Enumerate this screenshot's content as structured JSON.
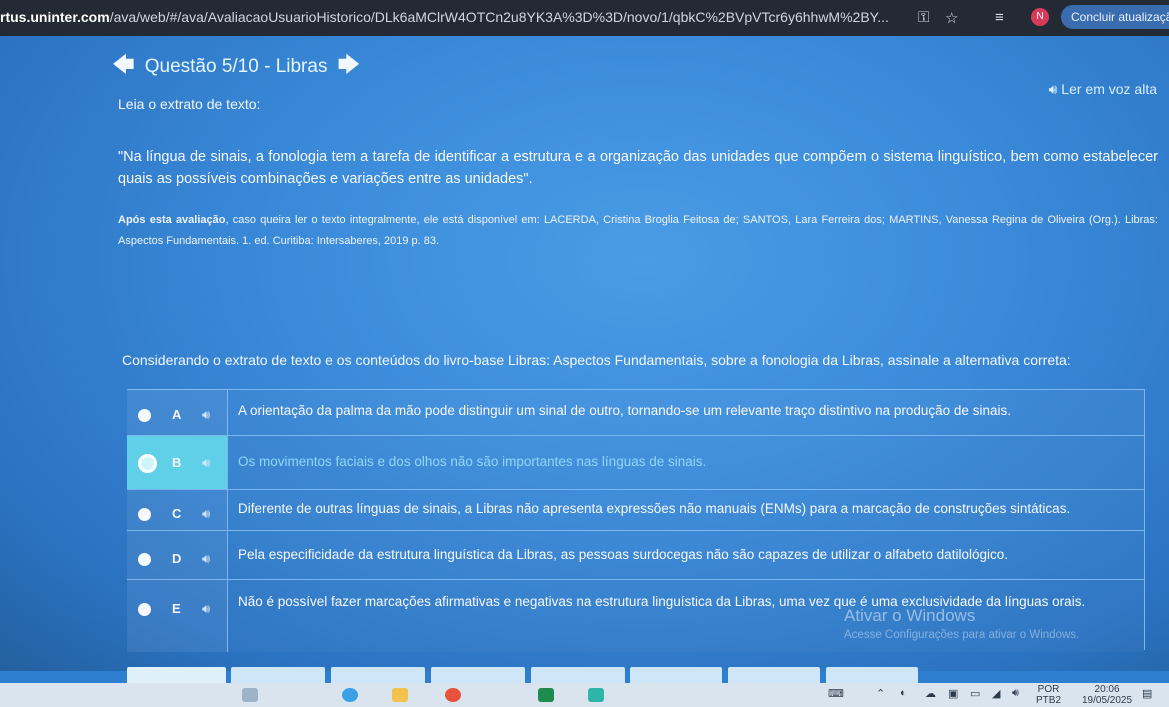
{
  "browser": {
    "url_host": "rtus.uninter.com",
    "url_path": "/ava/web/#/ava/AvaliacaoUsuarioHistorico/DLk6aMClrW4OTCn2u8YK3A%3D%3D/novo/1/qbkC%2BVpVTcr6y6hhwM%2BY...",
    "profile_letter": "N",
    "update_button": "Concluir atualizaçã"
  },
  "header": {
    "question_title": "Questão 5/10 - Libras",
    "read_aloud": "Ler em voz alta"
  },
  "content": {
    "lead": "Leia o extrato de texto:",
    "quote": "\"Na língua de sinais, a fonologia tem a tarefa de identificar a estrutura e a organização das unidades que compõem o sistema linguístico, bem como estabelecer quais as possíveis combinações e variações entre as unidades\".",
    "source_bold": "Após esta avaliação",
    "source_rest": ", caso queira ler o texto integralmente, ele está disponível em: LACERDA, Cristina Broglia Feitosa de; SANTOS, Lara Ferreira dos; MARTINS, Vanessa Regina de Oliveira (Org.). Libras: Aspectos Fundamentais. 1. ed. Curitiba: Intersaberes, 2019 p. 83.",
    "prompt": "Considerando o extrato de texto e os conteúdos do livro-base Libras: Aspectos Fundamentais, sobre a fonologia da Libras, assinale a alternativa correta:"
  },
  "options": [
    {
      "letter": "A",
      "text": "A orientação da palma da mão pode distinguir um sinal de outro, tornando-se um relevante traço distintivo na produção de sinais."
    },
    {
      "letter": "B",
      "text": "Os movimentos faciais e dos olhos não são importantes nas línguas de sinais."
    },
    {
      "letter": "C",
      "text": "Diferente de outras línguas de sinais, a Libras não apresenta expressões não manuais (ENMs) para a marcação de construções sintáticas."
    },
    {
      "letter": "D",
      "text": "Pela especificidade da estrutura linguística da Libras, as pessoas surdocegas não são capazes de utilizar o alfabeto datilológico."
    },
    {
      "letter": "E",
      "text": "Não é possível fazer marcações afirmativas e negativas na estrutura linguística da Libras, uma vez que é uma exclusividade da línguas orais."
    }
  ],
  "selected_option": "B",
  "windows_watermark": {
    "title": "Ativar o Windows",
    "subtitle": "Acesse Configurações para ativar o Windows."
  },
  "taskbar": {
    "language": "POR",
    "language_sub": "PTB2",
    "time": "20:06",
    "date": "19/05/2025"
  },
  "colors": {
    "selected_cell": "#5fd0e8",
    "page_bg": "#3a8ad9"
  }
}
